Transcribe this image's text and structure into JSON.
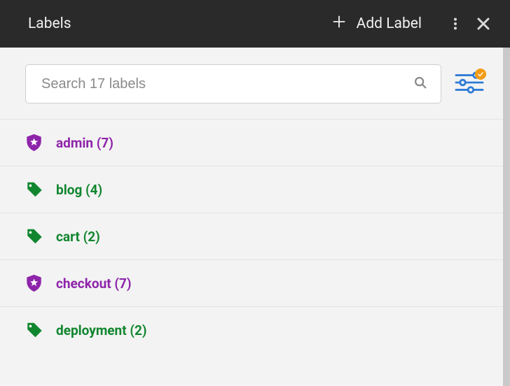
{
  "header": {
    "title": "Labels",
    "add_label": "Add Label"
  },
  "search": {
    "placeholder": "Search 17 labels"
  },
  "labels": [
    {
      "name": "admin",
      "count": 7,
      "icon": "shield",
      "color": "purple"
    },
    {
      "name": "blog",
      "count": 4,
      "icon": "tag",
      "color": "green"
    },
    {
      "name": "cart",
      "count": 2,
      "icon": "tag",
      "color": "green"
    },
    {
      "name": "checkout",
      "count": 7,
      "icon": "shield",
      "color": "purple"
    },
    {
      "name": "deployment",
      "count": 2,
      "icon": "tag",
      "color": "green"
    }
  ],
  "colors": {
    "purple": "#8e24aa",
    "green": "#11862f",
    "filter_accent": "#2f7cd6",
    "badge": "#f39c12"
  }
}
